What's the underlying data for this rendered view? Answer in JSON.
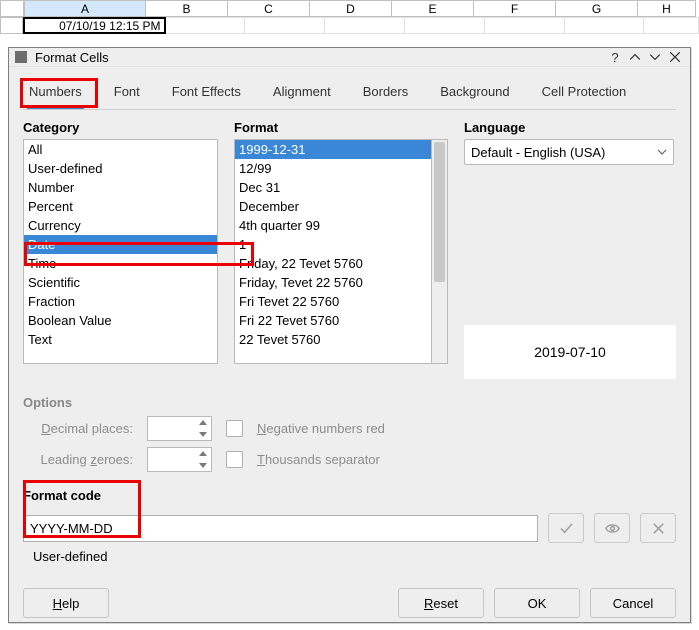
{
  "sheet": {
    "columns": [
      "A",
      "B",
      "C",
      "D",
      "E",
      "F",
      "G",
      "H"
    ],
    "cell_a1": "07/10/19 12:15 PM"
  },
  "dialog": {
    "title": "Format Cells",
    "tabs": [
      "Numbers",
      "Font",
      "Font Effects",
      "Alignment",
      "Borders",
      "Background",
      "Cell Protection"
    ],
    "active_tab": "Numbers",
    "category_label": "Category",
    "categories": [
      "All",
      "User-defined",
      "Number",
      "Percent",
      "Currency",
      "Date",
      "Time",
      "Scientific",
      "Fraction",
      "Boolean Value",
      "Text"
    ],
    "category_selected": "Date",
    "format_label": "Format",
    "formats": [
      "1999-12-31",
      "12/99",
      "Dec 31",
      "December",
      "4th quarter 99",
      "1",
      "Friday, 22 Tevet 5760",
      "Friday, Tevet 22 5760",
      "Fri Tevet 22 5760",
      "Fri 22 Tevet 5760",
      "22 Tevet 5760"
    ],
    "format_selected": "1999-12-31",
    "language_label": "Language",
    "language_value": "Default - English (USA)",
    "preview": "2019-07-10",
    "options_label": "Options",
    "decimal_places_label": "Decimal places:",
    "leading_zeroes_label": "Leading zeroes:",
    "neg_red_label": "Negative numbers red",
    "thousands_label": "Thousands separator",
    "format_code_label": "Format code",
    "format_code_value": "YYYY-MM-DD",
    "user_defined_label": "User-defined",
    "buttons": {
      "help": "Help",
      "reset": "Reset",
      "ok": "OK",
      "cancel": "Cancel"
    }
  }
}
